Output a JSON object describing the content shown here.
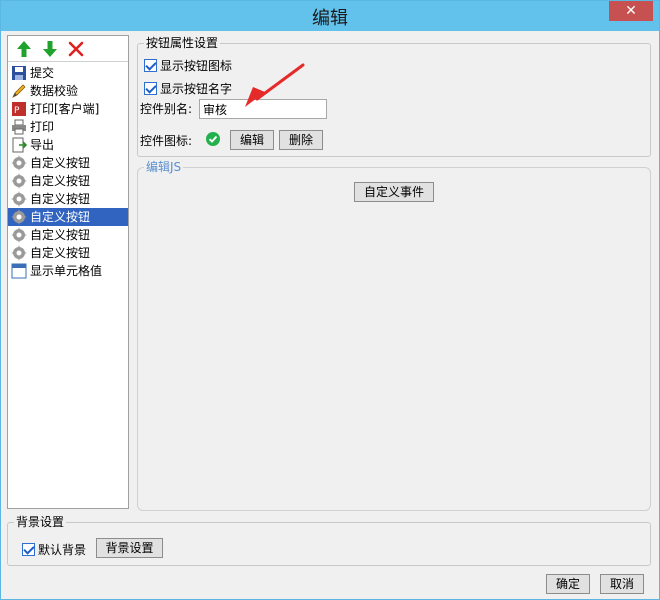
{
  "window": {
    "title": "编辑",
    "close_glyph": "✕"
  },
  "toolbar": {
    "icons": [
      "arrow-up-icon",
      "arrow-down-icon",
      "delete-icon"
    ],
    "colors": {
      "arrow": "#1fa32c",
      "delete": "#e02020"
    }
  },
  "list": {
    "items": [
      {
        "label": "提交",
        "icon": "save-icon"
      },
      {
        "label": "数据校验",
        "icon": "pencil-icon"
      },
      {
        "label": "打印[客户端]",
        "icon": "print-client-icon"
      },
      {
        "label": "打印",
        "icon": "printer-icon"
      },
      {
        "label": "导出",
        "icon": "export-icon"
      },
      {
        "label": "自定义按钮",
        "icon": "gear-icon"
      },
      {
        "label": "自定义按钮",
        "icon": "gear-icon"
      },
      {
        "label": "自定义按钮",
        "icon": "gear-icon"
      },
      {
        "label": "自定义按钮",
        "icon": "gear-icon",
        "selected": true
      },
      {
        "label": "自定义按钮",
        "icon": "gear-icon"
      },
      {
        "label": "自定义按钮",
        "icon": "gear-icon"
      },
      {
        "label": "显示单元格值",
        "icon": "cell-icon"
      }
    ],
    "selected_color": "#3164c0"
  },
  "props": {
    "title": "按钮属性设置",
    "show_icon_label": "显示按钮图标",
    "show_name_label": "显示按钮名字",
    "alias_label": "控件别名:",
    "alias_value": "审核",
    "icon_label": "控件图标:",
    "edit_button": "编辑",
    "delete_button": "删除"
  },
  "js": {
    "title": "编辑JS",
    "event_button": "自定义事件"
  },
  "background": {
    "title": "背景设置",
    "default_label": "默认背景",
    "settings_button": "背景设置"
  },
  "footer": {
    "ok": "确定",
    "cancel": "取消"
  },
  "colors": {
    "titlebar": "#62c2ec",
    "close": "#c75050",
    "annotation_arrow": "#e52a2a",
    "check_green": "#22b14c"
  }
}
